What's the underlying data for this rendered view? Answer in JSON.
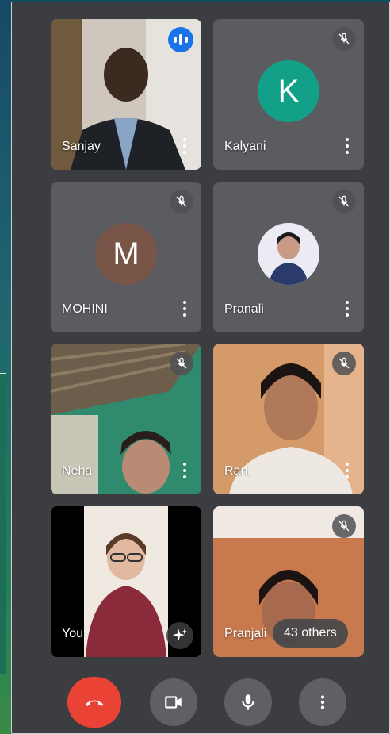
{
  "participants": [
    {
      "name": "Sanjay",
      "status": "speaking"
    },
    {
      "name": "Kalyani",
      "initial": "K",
      "avatar_color": "#12a089",
      "status": "muted"
    },
    {
      "name": "MOHINI",
      "initial": "M",
      "avatar_color": "#795548",
      "status": "muted"
    },
    {
      "name": "Pranali",
      "status": "muted"
    },
    {
      "name": "Neha",
      "status": "muted"
    },
    {
      "name": "Rani",
      "status": "muted"
    },
    {
      "name": "You",
      "status": "self"
    },
    {
      "name": "Pranjali",
      "status": "muted"
    }
  ],
  "others_label": "43 others",
  "controls": {
    "end_call": "call-end-icon",
    "camera": "videocam-icon",
    "microphone": "mic-icon",
    "more": "more-vert-icon"
  },
  "colors": {
    "window_bg": "#3c3d40",
    "tile_bg": "#5b5c60",
    "end_call": "#ea4335",
    "speaking": "#1a73e8"
  }
}
